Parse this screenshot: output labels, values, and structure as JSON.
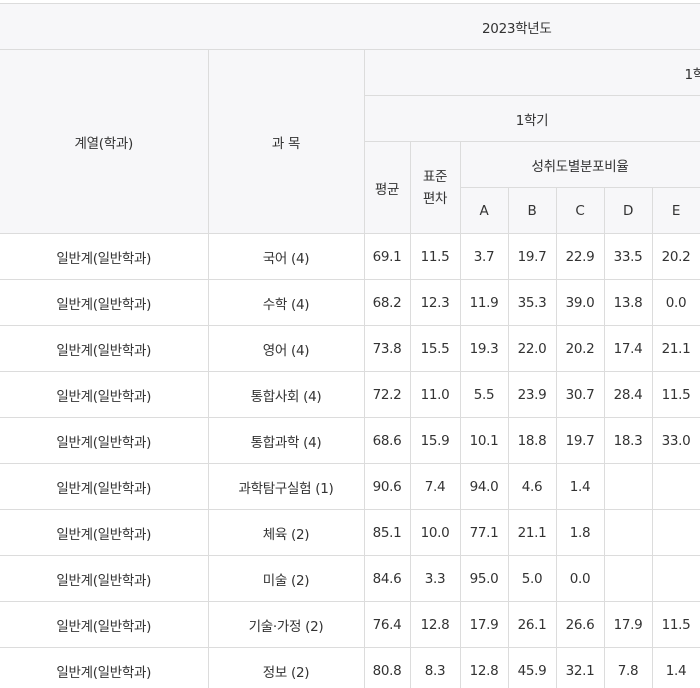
{
  "header": {
    "year": "2023학년도",
    "semester_partial": "1학",
    "half": "1학기",
    "col_dept": "계열(학과)",
    "col_subject": "과 목",
    "col_avg": "평균",
    "col_std": "표준편차",
    "col_std_line1": "표준",
    "col_std_line2": "편차",
    "col_dist": "성취도별분포비율",
    "grades": [
      "A",
      "B",
      "C",
      "D",
      "E"
    ]
  },
  "rows": [
    {
      "dept": "일반계(일반학과)",
      "subject": "국어 (4)",
      "avg": "69.1",
      "std": "11.5",
      "a": "3.7",
      "b": "19.7",
      "c": "22.9",
      "d": "33.5",
      "e": "20.2"
    },
    {
      "dept": "일반계(일반학과)",
      "subject": "수학 (4)",
      "avg": "68.2",
      "std": "12.3",
      "a": "11.9",
      "b": "35.3",
      "c": "39.0",
      "d": "13.8",
      "e": "0.0"
    },
    {
      "dept": "일반계(일반학과)",
      "subject": "영어 (4)",
      "avg": "73.8",
      "std": "15.5",
      "a": "19.3",
      "b": "22.0",
      "c": "20.2",
      "d": "17.4",
      "e": "21.1"
    },
    {
      "dept": "일반계(일반학과)",
      "subject": "통합사회 (4)",
      "avg": "72.2",
      "std": "11.0",
      "a": "5.5",
      "b": "23.9",
      "c": "30.7",
      "d": "28.4",
      "e": "11.5"
    },
    {
      "dept": "일반계(일반학과)",
      "subject": "통합과학 (4)",
      "avg": "68.6",
      "std": "15.9",
      "a": "10.1",
      "b": "18.8",
      "c": "19.7",
      "d": "18.3",
      "e": "33.0"
    },
    {
      "dept": "일반계(일반학과)",
      "subject": "과학탐구실험 (1)",
      "avg": "90.6",
      "std": "7.4",
      "a": "94.0",
      "b": "4.6",
      "c": "1.4",
      "d": "",
      "e": ""
    },
    {
      "dept": "일반계(일반학과)",
      "subject": "체육 (2)",
      "avg": "85.1",
      "std": "10.0",
      "a": "77.1",
      "b": "21.1",
      "c": "1.8",
      "d": "",
      "e": ""
    },
    {
      "dept": "일반계(일반학과)",
      "subject": "미술 (2)",
      "avg": "84.6",
      "std": "3.3",
      "a": "95.0",
      "b": "5.0",
      "c": "0.0",
      "d": "",
      "e": ""
    },
    {
      "dept": "일반계(일반학과)",
      "subject": "기술·가정 (2)",
      "avg": "76.4",
      "std": "12.8",
      "a": "17.9",
      "b": "26.1",
      "c": "26.6",
      "d": "17.9",
      "e": "11.5"
    },
    {
      "dept": "일반계(일반학과)",
      "subject": "정보 (2)",
      "avg": "80.8",
      "std": "8.3",
      "a": "12.8",
      "b": "45.9",
      "c": "32.1",
      "d": "7.8",
      "e": "1.4"
    }
  ]
}
